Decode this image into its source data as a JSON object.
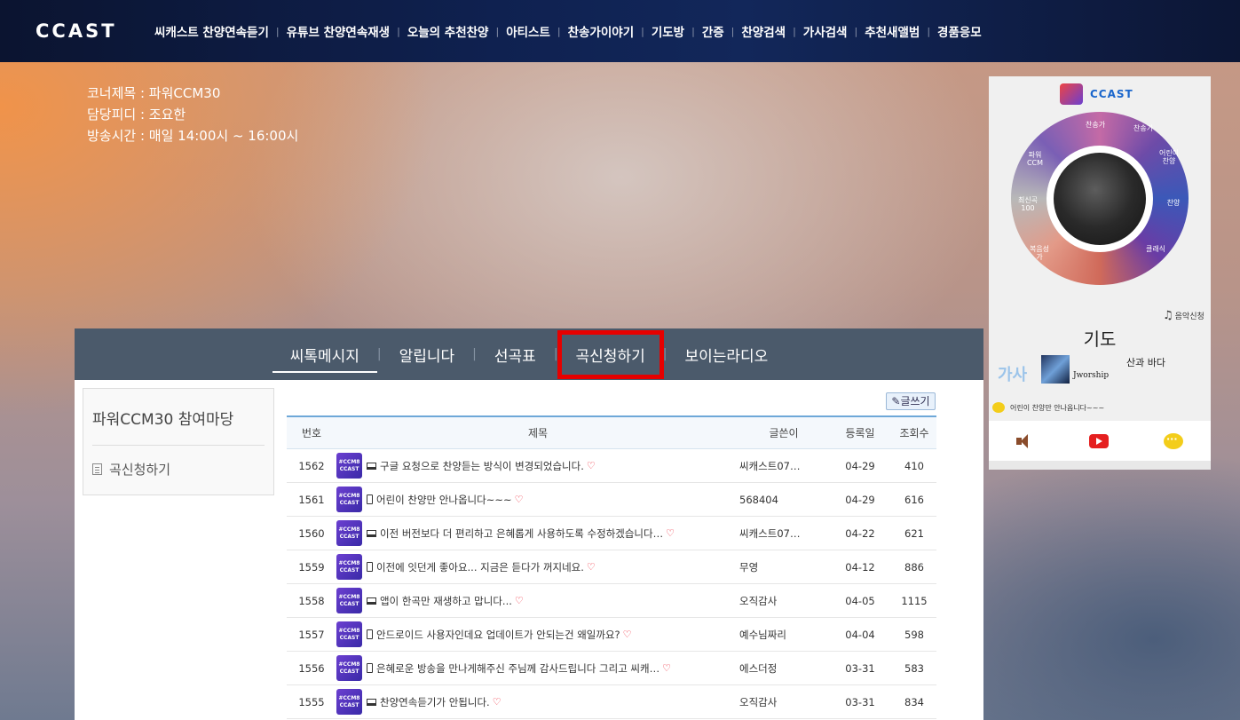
{
  "nav": {
    "logo": "CCAST",
    "items": [
      "씨캐스트 찬양연속듣기",
      "유튜브 찬양연속재생",
      "오늘의 추천찬양",
      "아티스트",
      "찬송가이야기",
      "기도방",
      "간증",
      "찬양검색",
      "가사검색",
      "추천새앨범",
      "경품응모"
    ]
  },
  "corner_info": {
    "title": "코너제목 : 파워CCM30",
    "pd": "담당피디 : 조요한",
    "time": "방송시간 : 매일 14:00시 ~ 16:00시"
  },
  "tabs": [
    "씨톡메시지",
    "알립니다",
    "선곡표",
    "곡신청하기",
    "보이는라디오"
  ],
  "sidebar": {
    "title": "파워CCM30 참여마당",
    "link": "곡신청하기"
  },
  "board": {
    "write_label": "글쓰기",
    "headers": {
      "no": "번호",
      "title": "제목",
      "writer": "글쓴이",
      "date": "등록일",
      "views": "조회수"
    },
    "thumb_text": [
      "#CCM8",
      "CCAST"
    ],
    "rows": [
      {
        "no": "1562",
        "device": "pc",
        "title": "구글 요청으로 찬양듣는 방식이 변경되었습니다.",
        "writer": "씨캐스트07…",
        "date": "04-29",
        "views": "410"
      },
      {
        "no": "1561",
        "device": "mobile",
        "title": "어린이 찬양만 안나옵니다~~~",
        "writer": "568404",
        "date": "04-29",
        "views": "616"
      },
      {
        "no": "1560",
        "device": "pc",
        "title": "이전 버전보다 더 편리하고 은혜롭게 사용하도록 수정하겠습니다…",
        "writer": "씨캐스트07…",
        "date": "04-22",
        "views": "621"
      },
      {
        "no": "1559",
        "device": "mobile",
        "title": "이전에 잇던게 좋아요... 지금은 듣다가 꺼지네요.",
        "writer": "무영",
        "date": "04-12",
        "views": "886"
      },
      {
        "no": "1558",
        "device": "pc",
        "title": "앱이 한곡만 재생하고 맙니다...",
        "writer": "오직감사",
        "date": "04-05",
        "views": "1115"
      },
      {
        "no": "1557",
        "device": "mobile",
        "title": "안드로이드 사용자인데요 업데이트가 안되는건 왜일까요?",
        "writer": "예수님짜리",
        "date": "04-04",
        "views": "598"
      },
      {
        "no": "1556",
        "device": "mobile",
        "title": "은혜로운 방송을 만나게해주신 주님께 감사드립니다 그리고 씨캐…",
        "writer": "에스더정",
        "date": "03-31",
        "views": "583"
      },
      {
        "no": "1555",
        "device": "pc",
        "title": "찬양연속듣기가 안됩니다.",
        "writer": "오직감사",
        "date": "03-31",
        "views": "834"
      }
    ]
  },
  "player": {
    "logo_text": "CCAST",
    "wheel_labels": [
      "찬송가",
      "찬송가",
      "어린이찬양",
      "최신곡100",
      "파워CCM",
      "찬양",
      "복음성가",
      "클래식"
    ],
    "request_label": "음악신청",
    "song_title": "기도",
    "lyric_label": "가사",
    "album_label": "Jworship",
    "artist": "산과 바다",
    "comment": "어린이 찬양만 안나옵니다~~~"
  }
}
